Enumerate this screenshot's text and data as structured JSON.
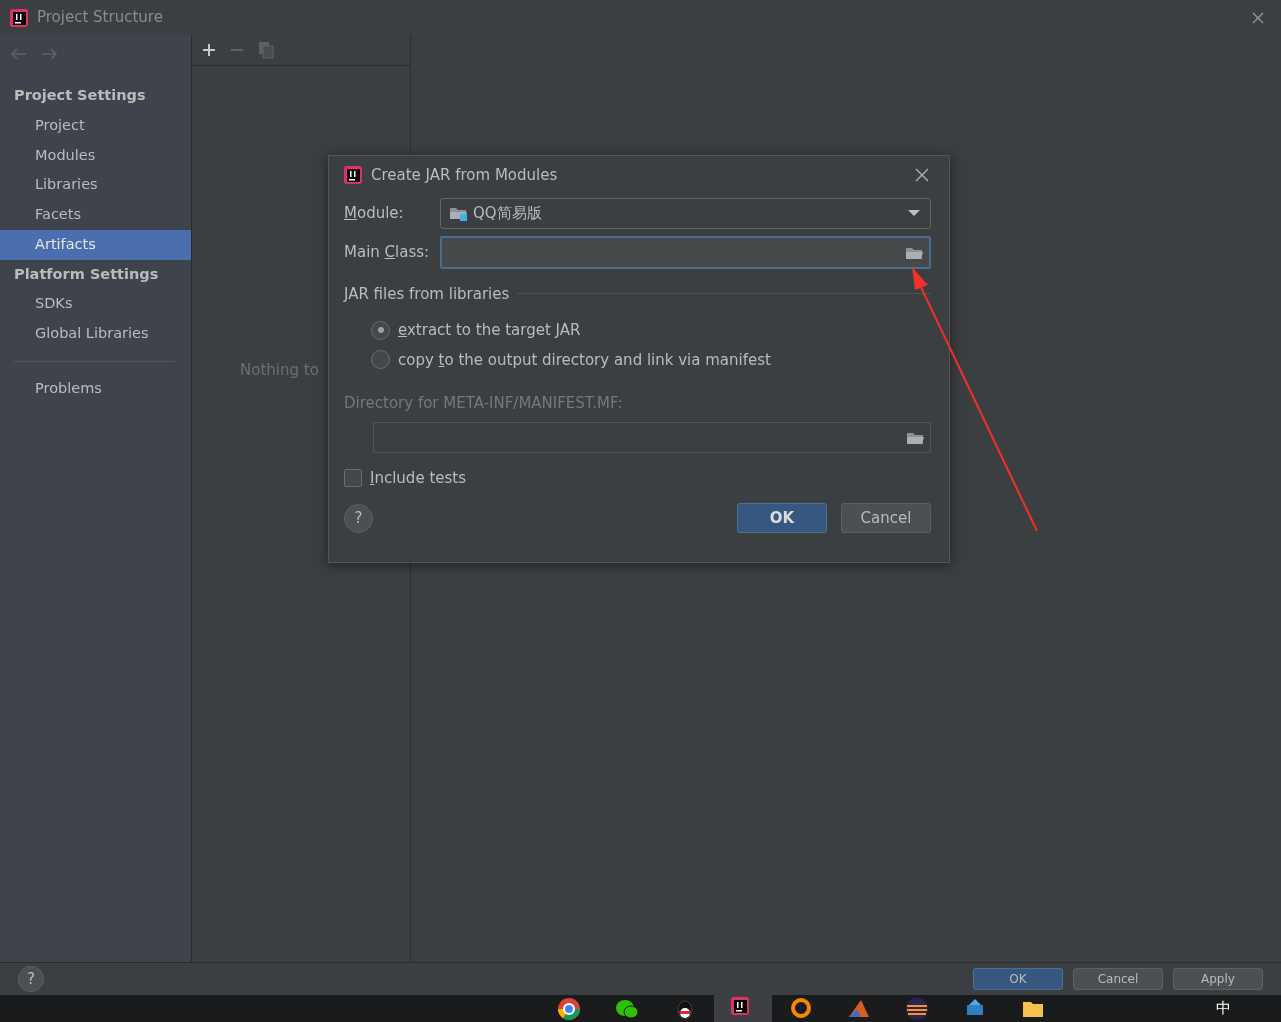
{
  "window": {
    "title": "Project Structure"
  },
  "sidebar": {
    "sections": [
      {
        "heading": "Project Settings",
        "items": [
          {
            "label": "Project",
            "selected": false
          },
          {
            "label": "Modules",
            "selected": false
          },
          {
            "label": "Libraries",
            "selected": false
          },
          {
            "label": "Facets",
            "selected": false
          },
          {
            "label": "Artifacts",
            "selected": true
          }
        ]
      },
      {
        "heading": "Platform Settings",
        "items": [
          {
            "label": "SDKs",
            "selected": false
          },
          {
            "label": "Global Libraries",
            "selected": false
          }
        ]
      }
    ],
    "extra_items": [
      {
        "label": "Problems",
        "selected": false
      }
    ]
  },
  "middle": {
    "empty_text": "Nothing to"
  },
  "dialog": {
    "title": "Create JAR from Modules",
    "module": {
      "label_parts": [
        {
          "text": "M",
          "underlined": true
        },
        {
          "text": "odule:",
          "underlined": false
        }
      ],
      "value": "QQ简易版"
    },
    "main_class": {
      "label_parts": [
        {
          "text": "Main ",
          "underlined": false
        },
        {
          "text": "C",
          "underlined": true
        },
        {
          "text": "lass:",
          "underlined": false
        }
      ],
      "focused": true
    },
    "libraries_heading": "JAR files from libraries",
    "options": [
      {
        "label_parts": [
          {
            "text": "e",
            "underlined": true
          },
          {
            "text": "xtract to the target JAR",
            "underlined": false
          }
        ],
        "selected": true
      },
      {
        "label_parts": [
          {
            "text": "copy ",
            "underlined": false
          },
          {
            "text": "t",
            "underlined": true
          },
          {
            "text": "o the output directory and link via manifest",
            "underlined": false
          }
        ],
        "selected": false
      }
    ],
    "manifest": {
      "label": "Directory for META-INF/MANIFEST.MF:",
      "disabled": true
    },
    "include_tests": {
      "label_parts": [
        {
          "text": "I",
          "underlined": true
        },
        {
          "text": "nclude tests",
          "underlined": false
        }
      ],
      "checked": false
    },
    "help": "?",
    "buttons": [
      {
        "label": "OK",
        "default": true
      },
      {
        "label": "Cancel",
        "default": false
      }
    ]
  },
  "footer": {
    "help": "?",
    "buttons": [
      {
        "label": "OK",
        "default": true
      },
      {
        "label": "Cancel",
        "default": false
      },
      {
        "label": "Apply",
        "default": false
      }
    ]
  },
  "taskbar": {
    "ime_indicator": "中"
  }
}
